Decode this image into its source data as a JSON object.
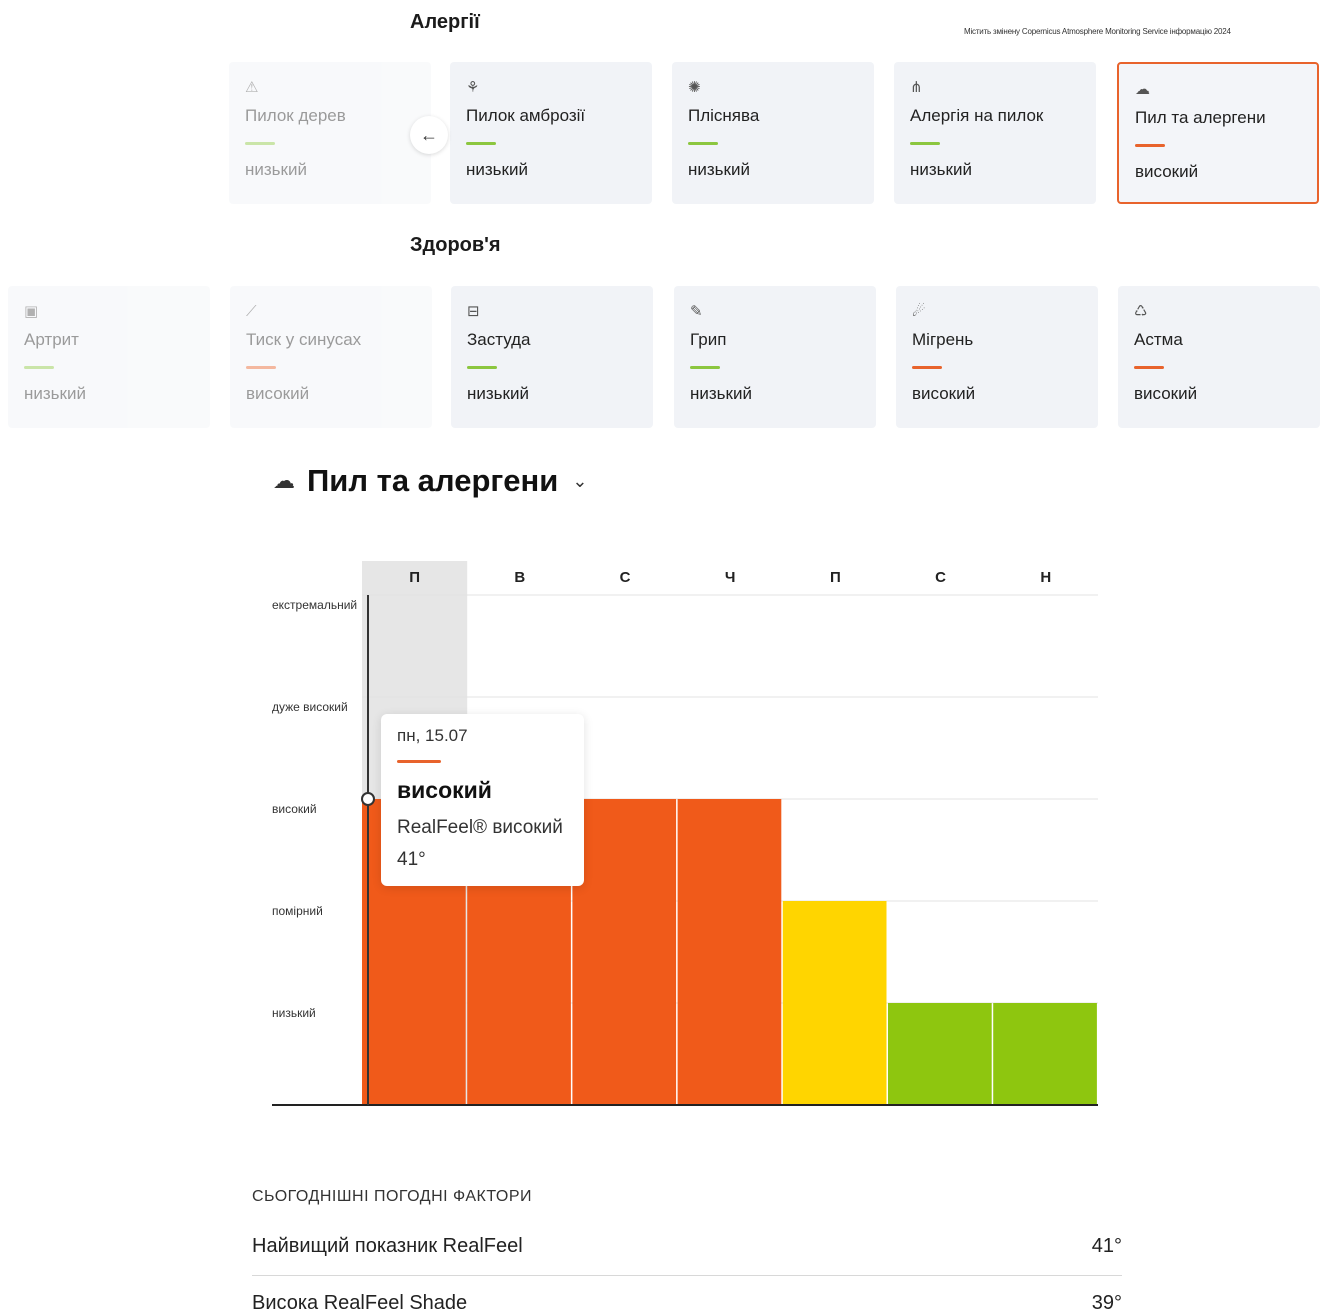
{
  "allergies": {
    "title": "Алергії",
    "attribution": "Містить змінену Copernicus Atmosphere Monitoring Service інформацію 2024",
    "cards": [
      {
        "icon": "tree-icon",
        "glyph": "⚠",
        "label": "Пилок дерев",
        "level": "низький",
        "color": "#8cc63f",
        "faded": true
      },
      {
        "icon": "ragweed-icon",
        "glyph": "⚘",
        "label": "Пилок амброзії",
        "level": "низький",
        "color": "#8cc63f"
      },
      {
        "icon": "mold-icon",
        "glyph": "✺",
        "label": "Пліснява",
        "level": "низький",
        "color": "#8cc63f"
      },
      {
        "icon": "grass-icon",
        "glyph": "⋔",
        "label": "Алергія на пилок",
        "level": "низький",
        "color": "#8cc63f"
      },
      {
        "icon": "dust-icon",
        "glyph": "☁",
        "label": "Пил та алергени",
        "level": "високий",
        "color": "#e8632c",
        "active": true
      }
    ]
  },
  "health": {
    "title": "Здоров'я",
    "cards": [
      {
        "icon": "arthritis-icon",
        "glyph": "▣",
        "label": "Артрит",
        "level": "низький",
        "color": "#8cc63f",
        "faded": true
      },
      {
        "icon": "sinus-icon",
        "glyph": "⟋",
        "label": "Тиск у синусах",
        "level": "високий",
        "color": "#e8632c",
        "faded": true
      },
      {
        "icon": "cold-icon",
        "glyph": "⊟",
        "label": "Застуда",
        "level": "низький",
        "color": "#8cc63f"
      },
      {
        "icon": "flu-icon",
        "glyph": "✎",
        "label": "Грип",
        "level": "низький",
        "color": "#8cc63f"
      },
      {
        "icon": "migraine-icon",
        "glyph": "☄",
        "label": "Мігрень",
        "level": "високий",
        "color": "#e8632c"
      },
      {
        "icon": "asthma-icon",
        "glyph": "♺",
        "label": "Астма",
        "level": "високий",
        "color": "#e8632c"
      }
    ]
  },
  "detail": {
    "title": "Пил та алергени"
  },
  "chart_data": {
    "type": "bar",
    "categories": [
      "П",
      "В",
      "С",
      "Ч",
      "П",
      "С",
      "Н"
    ],
    "levels": [
      "низький",
      "помірний",
      "високий",
      "дуже високий",
      "екстремальний"
    ],
    "values": [
      3,
      3,
      3,
      3,
      2,
      1,
      1
    ],
    "colors": [
      "#f05a1a",
      "#f05a1a",
      "#f05a1a",
      "#f05a1a",
      "#ffd500",
      "#8ec60f",
      "#8ec60f"
    ],
    "highlight_index": 0,
    "ylim": [
      0,
      5
    ]
  },
  "tooltip": {
    "date": "пн, 15.07",
    "level": "високий",
    "realfeel_label": "RealFeel® високий",
    "realfeel_value": "41°"
  },
  "factors": {
    "title": "СЬОГОДНІШНІ ПОГОДНІ ФАКТОРИ",
    "rows": [
      {
        "label": "Найвищий показник RealFeel",
        "value": "41°"
      },
      {
        "label": "Висока RealFeel Shade",
        "value": "39°"
      }
    ]
  }
}
